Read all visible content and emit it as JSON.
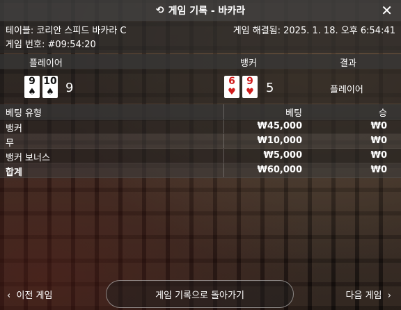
{
  "title": "게임 기록 - 바카라",
  "close_icon_label": "✕",
  "info": {
    "table": "테이블: 코리안 스피드 바카라 C",
    "game_no": "게임 번호: #09:54:20",
    "settled": "게임 해결됨: 2025. 1. 18. 오후 6:54:41"
  },
  "results": {
    "headers": [
      "플레이어",
      "뱅커",
      "결과"
    ],
    "player": {
      "cards": [
        {
          "rank": "9",
          "suit": "♠",
          "color": "black"
        },
        {
          "rank": "10",
          "suit": "♠",
          "color": "black"
        }
      ],
      "score": "9"
    },
    "banker": {
      "cards": [
        {
          "rank": "6",
          "suit": "♥",
          "color": "red"
        },
        {
          "rank": "9",
          "suit": "♥",
          "color": "red"
        }
      ],
      "score": "5"
    },
    "outcome": "플레이어"
  },
  "bets": {
    "headers": [
      "베팅 유형",
      "베팅",
      "승"
    ],
    "rows": [
      {
        "type": "뱅커",
        "bet": "₩45,000",
        "win": "₩0"
      },
      {
        "type": "무",
        "bet": "₩10,000",
        "win": "₩0"
      },
      {
        "type": "뱅커 보너스",
        "bet": "₩5,000",
        "win": "₩0"
      }
    ],
    "total": {
      "type": "합계",
      "bet": "₩60,000",
      "win": "₩0"
    }
  },
  "footer": {
    "prev": "이전 게임",
    "back": "게임 기록으로 돌아가기",
    "next": "다음 게임"
  }
}
